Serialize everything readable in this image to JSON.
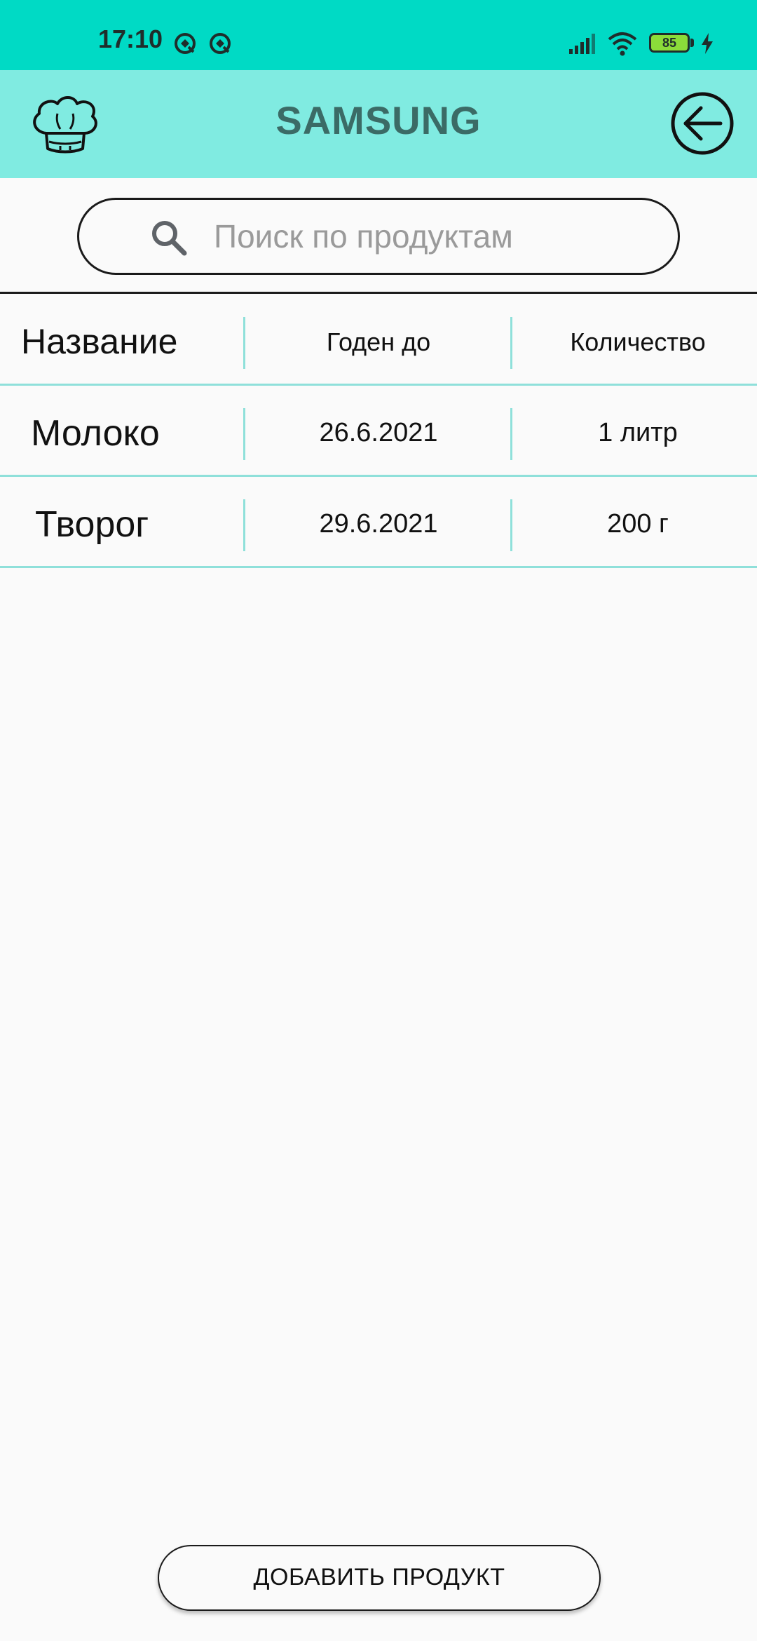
{
  "status_bar": {
    "time": "17:10",
    "battery": "85",
    "icons": [
      "sync-icon",
      "sync-icon",
      "signal-icon",
      "wifi-icon",
      "battery-icon",
      "charging-icon"
    ],
    "colors": {
      "background": "#00dac5"
    }
  },
  "app_bar": {
    "title": "SAMSUNG",
    "logo_icon": "chef-hat-icon",
    "back_icon": "arrow-left-circle-icon",
    "colors": {
      "background": "#80ebe1",
      "title": "#3b6b66"
    }
  },
  "search": {
    "placeholder": "Поиск по продуктам",
    "value": "",
    "icon": "search-icon"
  },
  "table": {
    "headers": {
      "name": "Название",
      "expires": "Годен до",
      "quantity": "Количество"
    },
    "rows": [
      {
        "name": "Молоко",
        "expires": "26.6.2021",
        "quantity": "1 литр"
      },
      {
        "name": "Творог",
        "expires": "29.6.2021",
        "quantity": "200 г"
      }
    ],
    "colors": {
      "divider": "#8fe0da"
    }
  },
  "actions": {
    "add_label": "ДОБАВИТЬ ПРОДУКТ"
  }
}
